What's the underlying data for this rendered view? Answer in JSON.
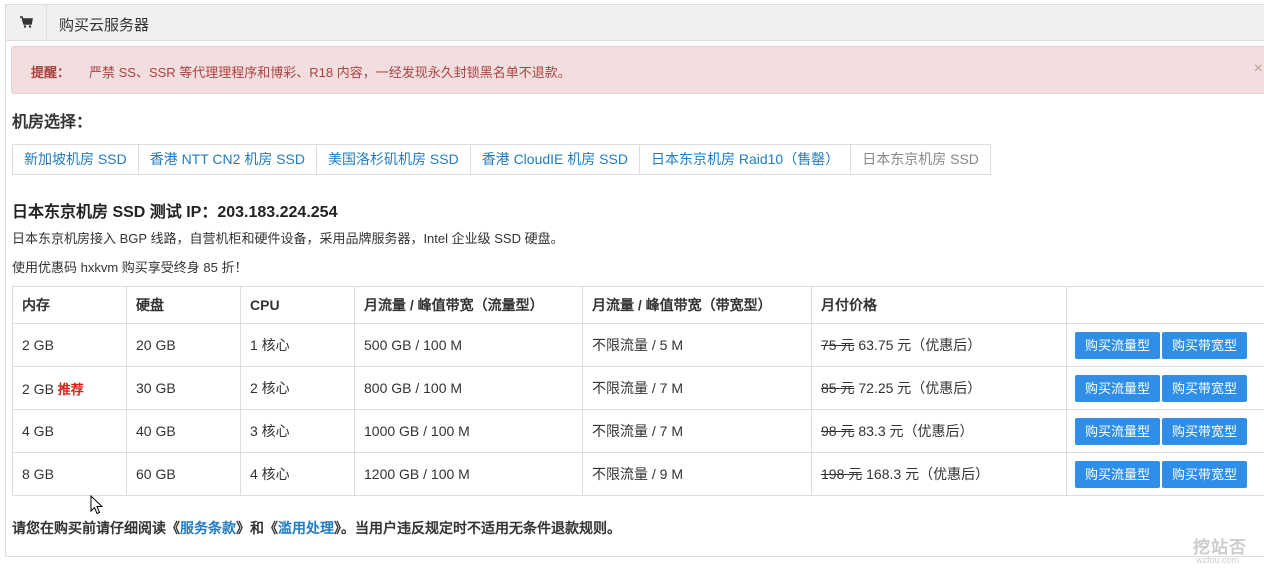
{
  "header": {
    "title": "购买云服务器",
    "icon": "cart-icon"
  },
  "alert": {
    "label": "提醒：",
    "text": "严禁 SS、SSR 等代理理程序和博彩、R18 内容，一经发现永久封锁黑名单不退款。",
    "close": "×"
  },
  "datacenter_select": {
    "label": "机房选择：",
    "tabs": [
      "新加坡机房 SSD",
      "香港 NTT CN2 机房 SSD",
      "美国洛杉矶机房 SSD",
      "香港 CloudIE 机房 SSD",
      "日本东京机房 Raid10（售罄）",
      "日本东京机房 SSD"
    ],
    "active_index": 5
  },
  "datacenter": {
    "title": "日本东京机房 SSD 测试 IP：203.183.224.254",
    "description": "日本东京机房接入 BGP 线路，自营机柜和硬件设备，采用品牌服务器，Intel 企业级 SSD 硬盘。",
    "promo": "使用优惠码 hxkvm 购买享受终身 85 折！"
  },
  "table": {
    "headers": [
      "内存",
      "硬盘",
      "CPU",
      "月流量 / 峰值带宽（流量型）",
      "月流量 / 峰值带宽（带宽型）",
      "月付价格",
      ""
    ],
    "rows": [
      {
        "memory": "2 GB",
        "badge": "",
        "disk": "20 GB",
        "cpu": "1 核心",
        "traffic": "500 GB / 100 M",
        "bandwidth": "不限流量 / 5 M",
        "old_price": "75 元",
        "price": "63.75 元（优惠后）"
      },
      {
        "memory": "2 GB",
        "badge": "推荐",
        "disk": "30 GB",
        "cpu": "2 核心",
        "traffic": "800 GB / 100 M",
        "bandwidth": "不限流量 / 7 M",
        "old_price": "85 元",
        "price": "72.25 元（优惠后）"
      },
      {
        "memory": "4 GB",
        "badge": "",
        "disk": "40 GB",
        "cpu": "3 核心",
        "traffic": "1000 GB / 100 M",
        "bandwidth": "不限流量 / 7 M",
        "old_price": "98 元",
        "price": "83.3 元（优惠后）"
      },
      {
        "memory": "8 GB",
        "badge": "",
        "disk": "60 GB",
        "cpu": "4 核心",
        "traffic": "1200 GB / 100 M",
        "bandwidth": "不限流量 / 9 M",
        "old_price": "198 元",
        "price": "168.3 元（优惠后）"
      }
    ],
    "buy_traffic_label": "购买流量型",
    "buy_bandwidth_label": "购买带宽型"
  },
  "notice": {
    "prefix": "请您在购买前请仔细阅读《",
    "terms_link": "服务条款",
    "mid": "》和《",
    "abuse_link": "滥用处理",
    "suffix": "》。当用户违反规定时不适用无条件退款规则。"
  },
  "watermark": {
    "text": "挖站否",
    "sub": "wzfou.com"
  },
  "colors": {
    "link": "#1f7cc4",
    "button": "#2e8ee8",
    "alert_bg": "#f2dede",
    "alert_text": "#a94442",
    "badge": "#d9221b"
  }
}
